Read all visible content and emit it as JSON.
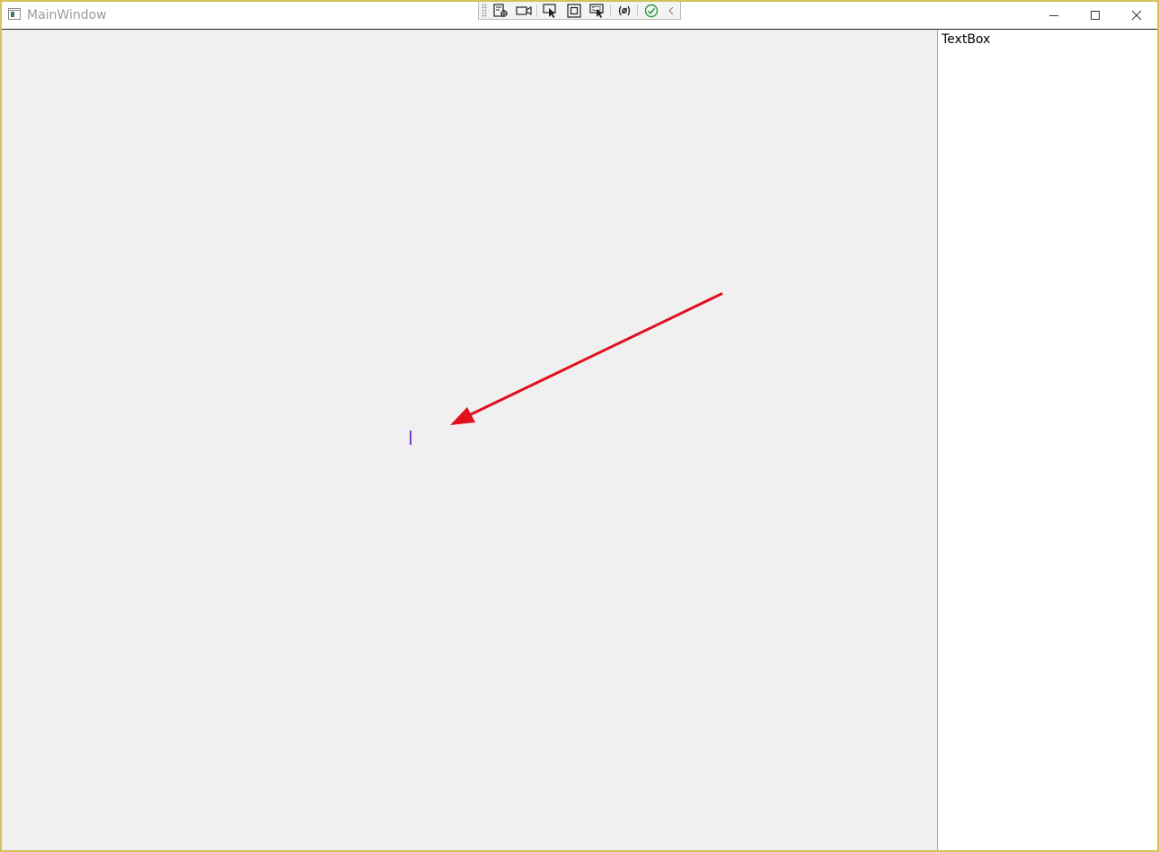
{
  "window": {
    "title": "MainWindow"
  },
  "debug_toolbar": {
    "icons": [
      "live-visual-tree-icon",
      "record-icon",
      "select-element-icon",
      "display-layout-adorners-icon",
      "track-focus-icon",
      "binding-failures-icon",
      "hot-reload-ok-icon",
      "collapse-toolbar-icon"
    ]
  },
  "window_controls": [
    "minimize-icon",
    "maximize-icon",
    "close-icon"
  ],
  "side_panel": {
    "textbox_text": "TextBox"
  },
  "colors": {
    "window_border": "#d4c25a",
    "canvas_background": "#f0f0f0",
    "caret": "#7b3fd0",
    "annotation_arrow": "#e0101e"
  }
}
